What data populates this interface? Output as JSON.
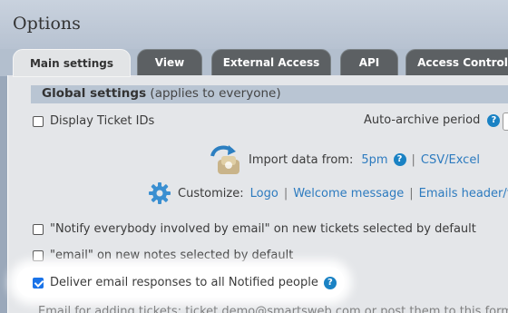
{
  "window": {
    "title": "Options"
  },
  "tabs": [
    {
      "label": "Main settings",
      "active": true
    },
    {
      "label": "View",
      "active": false
    },
    {
      "label": "External Access",
      "active": false
    },
    {
      "label": "API",
      "active": false
    },
    {
      "label": "Access Control",
      "active": false
    }
  ],
  "global_settings": {
    "heading": "Global settings",
    "subheading": "(applies to everyone)"
  },
  "display_ticket_ids": {
    "label": "Display Ticket IDs",
    "checked": false
  },
  "auto_archive": {
    "label": "Auto-archive period"
  },
  "import": {
    "label": "Import data from:",
    "source_5pm": "5pm",
    "separator": "|",
    "source_csv": "CSV/Excel"
  },
  "customize": {
    "label": "Customize:",
    "logo": "Logo",
    "welcome": "Welcome message",
    "emails_header": "Emails header/f",
    "separator": "|"
  },
  "options": {
    "notify_everybody": {
      "label": "\"Notify everybody involved by email\" on new tickets selected by default",
      "checked": false
    },
    "email_notes": {
      "label": "\"email\" on new notes selected by default",
      "checked": false
    },
    "deliver_responses": {
      "label": "Deliver email responses to all Notified people",
      "checked": true
    }
  },
  "footer_text": "Email for adding tickets: ticket.demo@smartsweb.com or post them to this form",
  "help_glyph": "?",
  "colors": {
    "accent": "#1a82c4",
    "link": "#2d7bbf",
    "tab_inactive": "#5c6063"
  }
}
